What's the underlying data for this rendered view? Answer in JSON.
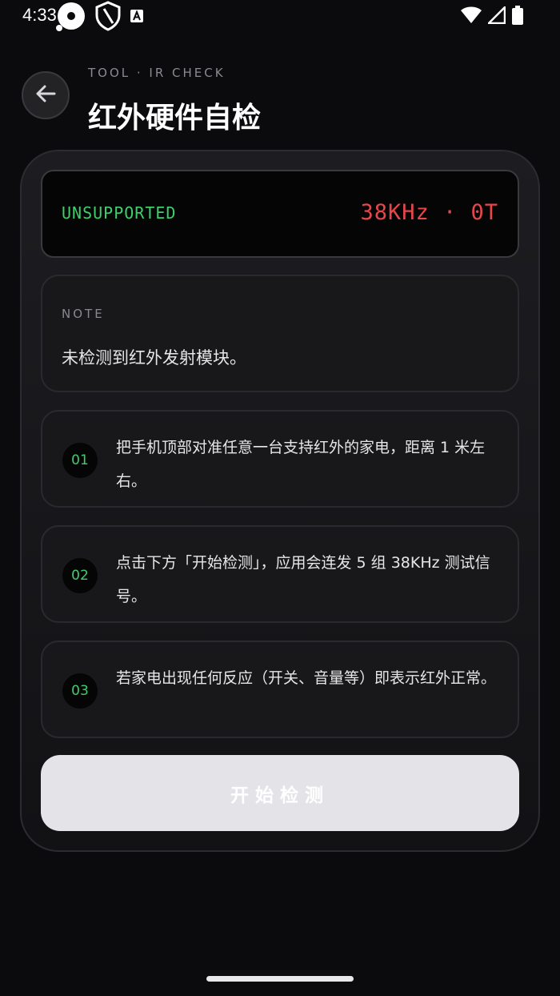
{
  "status_bar": {
    "time": "4:33",
    "icons": [
      "record-icon",
      "shield-icon",
      "font-a-icon",
      "wifi-icon",
      "signal-icon",
      "battery-icon"
    ]
  },
  "header": {
    "back_icon": "arrow-left-icon",
    "kicker": "TOOL · IR CHECK",
    "title": "红外硬件自检"
  },
  "display": {
    "status": "UNSUPPORTED",
    "reading": "38KHz · 0T",
    "status_color": "#3ecf6a",
    "reading_color": "#e5474b"
  },
  "note": {
    "label": "NOTE",
    "text": "未检测到红外发射模块。"
  },
  "steps": [
    {
      "num": "01",
      "text": "把手机顶部对准任意一台支持红外的家电，距离 1 米左右。"
    },
    {
      "num": "02",
      "text": "点击下方「开始检测」，应用会连发 5 组 38KHz 测试信号。"
    },
    {
      "num": "03",
      "text": "若家电出现任何反应（开关、音量等）即表示红外正常。"
    }
  ],
  "action": {
    "start_label": "开始检测"
  },
  "colors": {
    "background": "#0b0b0d",
    "accent_green": "#3ecf6a",
    "accent_red": "#e5474b"
  }
}
